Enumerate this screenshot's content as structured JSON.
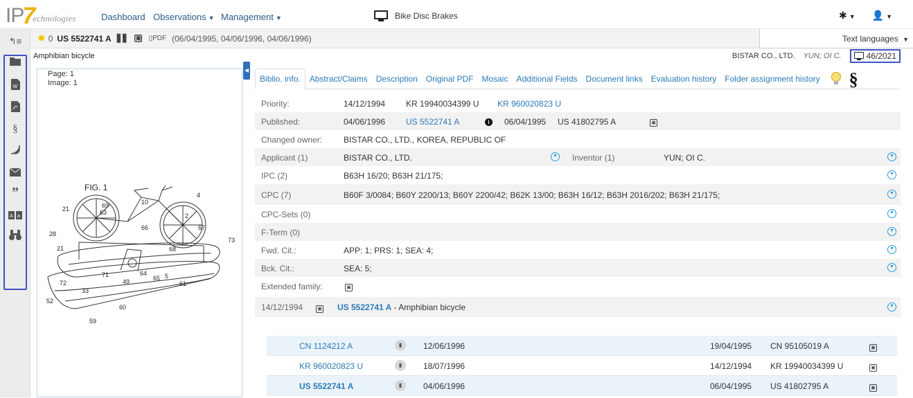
{
  "nav": {
    "logo_ip": "IP",
    "logo_seven": "7",
    "logo_tech": "echnologies",
    "dashboard": "Dashboard",
    "observations": "Observations",
    "management": "Management",
    "doc_title": "Bike Disc Brakes"
  },
  "leftbar": {
    "icons": [
      "back-list-icon",
      "folder-icon",
      "word-doc-icon",
      "pdf-doc-icon",
      "paragraph-icon",
      "signal-icon",
      "mail-icon",
      "quote-icon",
      "translate-icon",
      "binoculars-icon"
    ]
  },
  "header": {
    "count": "0",
    "patent_number": "US 5522741 A",
    "pdf_label": "PDF",
    "dates": "(06/04/1995, 04/06/1996, 04/06/1996)",
    "text_languages": "Text languages",
    "title": "Amphibian bicycle",
    "applicant": "BISTAR CO., LTD.",
    "inventor": "YUN; OI C.",
    "week": "46/2021"
  },
  "image_panel": {
    "page": "Page: 1",
    "image": "Image: 1",
    "fig": "FIG. 1"
  },
  "tabs": [
    "Biblio. info.",
    "Abstract/Claims",
    "Description",
    "Original PDF",
    "Mosaic",
    "Additional Fields",
    "Document links",
    "Evaluation history",
    "Folder assignment history"
  ],
  "biblio": {
    "priority_label": "Priority:",
    "priority_date": "14/12/1994",
    "priority_num1": "KR 19940034399 U",
    "priority_num2": "KR 960020823 U",
    "published_label": "Published:",
    "published_date": "04/06/1996",
    "published_num": "US 5522741 A",
    "published_date2": "06/04/1995",
    "published_num2": "US 41802795 A",
    "changed_owner_label": "Changed owner:",
    "changed_owner": "BISTAR CO., LTD., KOREA, REPUBLIC OF",
    "applicant_label": "Applicant (1)",
    "applicant": "BISTAR CO., LTD.",
    "inventor_label": "Inventor (1)",
    "inventor": "YUN; OI C.",
    "ipc_label": "IPC (2)",
    "ipc": "B63H 16/20; B63H 21/175;",
    "cpc_label": "CPC (7)",
    "cpc": "B60F 3/0084; B60Y 2200/13; B60Y 2200/42; B62K 13/00; B63H 16/12; B63H 2016/202; B63H 21/175;",
    "cpcsets_label": "CPC-Sets (0)",
    "fterm_label": "F-Term (0)",
    "fwd_label": "Fwd. Cit.:",
    "fwd": "APP: 1;  PRS: 1;  SEA: 4;",
    "bck_label": "Bck. Cit.:",
    "bck": "SEA: 5;",
    "ext_label": "Extended family:",
    "family_date": "14/12/1994",
    "family_num": "US 5522741 A",
    "family_title": " - Amphibian bicycle"
  },
  "family_rows": [
    {
      "num": "CN 1124212 A",
      "date": "12/06/1996",
      "pdate": "19/04/1995",
      "app": "CN 95105019 A"
    },
    {
      "num": "KR 960020823 U",
      "date": "18/07/1996",
      "pdate": "14/12/1994",
      "app": "KR 19940034399 U"
    },
    {
      "num": "US 5522741 A",
      "date": "04/06/1996",
      "pdate": "06/04/1995",
      "app": "US 41802795 A"
    }
  ]
}
